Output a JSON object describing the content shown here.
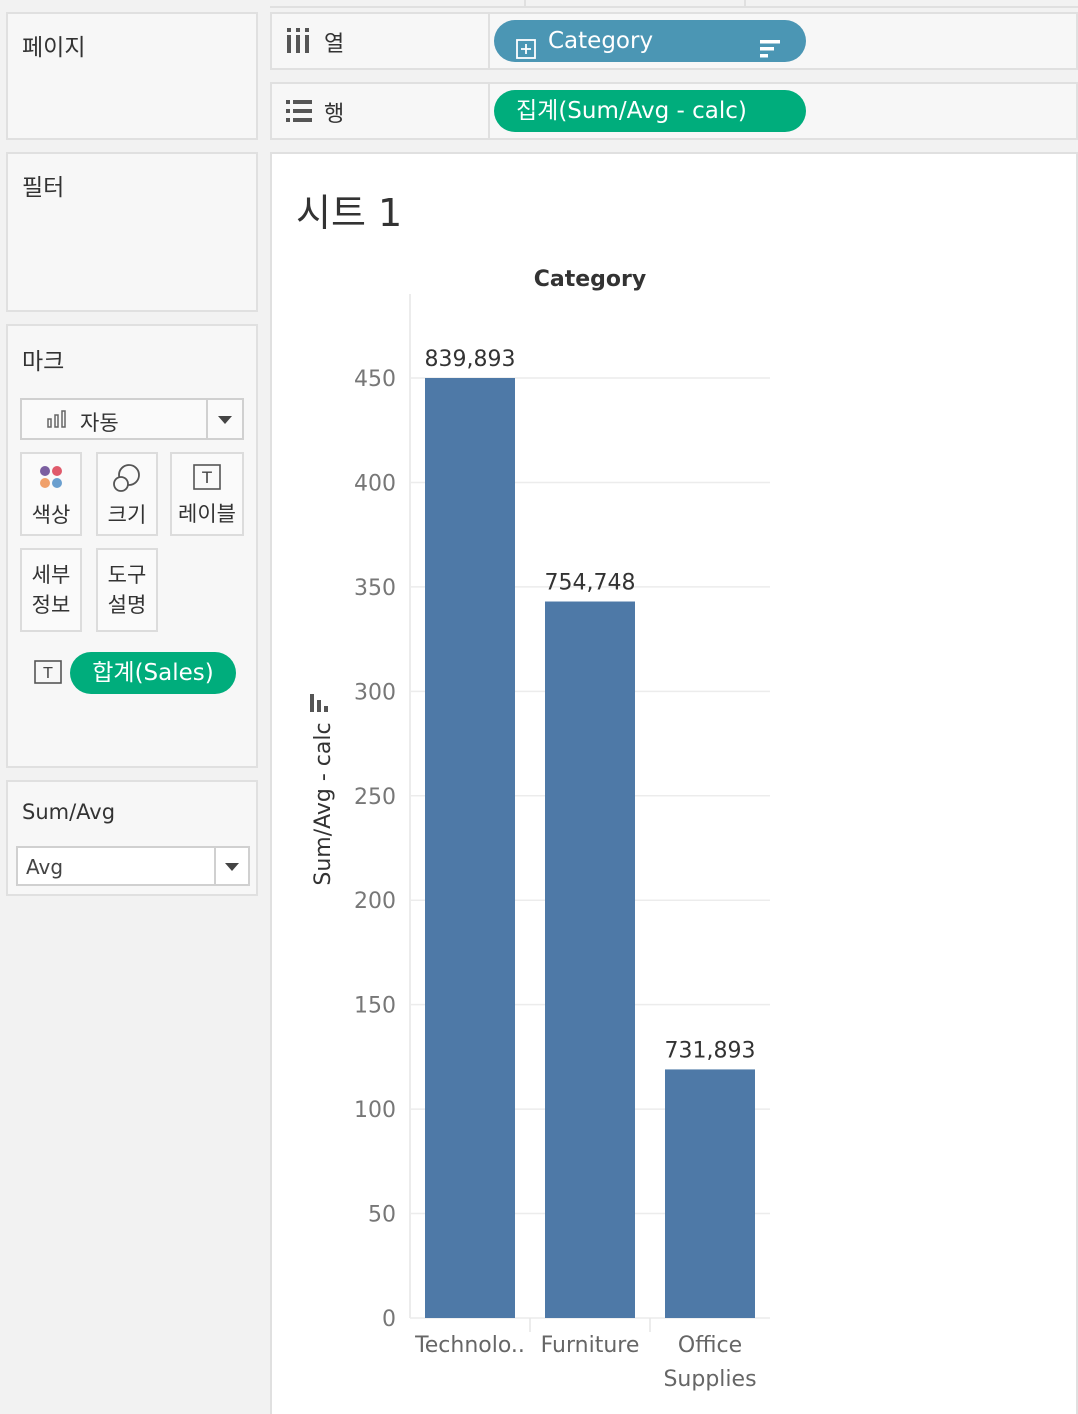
{
  "pages_panel": {
    "title": "페이지"
  },
  "filters_panel": {
    "title": "필터"
  },
  "marks_panel": {
    "title": "마크",
    "mark_type": "자동",
    "buttons": {
      "color": "색상",
      "size": "크기",
      "label": "레이블",
      "detail_line1": "세부",
      "detail_line2": "정보",
      "tooltip_line1": "도구",
      "tooltip_line2": "설명"
    },
    "label_pill": "합계(Sales)"
  },
  "parameter_panel": {
    "title": "Sum/Avg",
    "value": "Avg"
  },
  "shelves": {
    "columns": {
      "label": "열",
      "pill": "Category"
    },
    "rows": {
      "label": "행",
      "pill": "집계(Sum/Avg - calc)"
    }
  },
  "sheet": {
    "title": "시트 1"
  },
  "colors": {
    "bar": "#4e79a7",
    "pill_blue": "#4b96b4",
    "pill_green": "#00ad7c"
  },
  "chart_data": {
    "type": "bar",
    "title": "Category",
    "ylabel": "Sum/Avg - calc",
    "xlabel": "",
    "categories": [
      "Technolo..",
      "Furniture",
      "Office Supplies"
    ],
    "values": [
      450,
      343,
      119
    ],
    "data_labels": [
      "839,893",
      "754,748",
      "731,893"
    ],
    "ylim": [
      0,
      450
    ],
    "yticks": [
      0,
      50,
      100,
      150,
      200,
      250,
      300,
      350,
      400,
      450
    ],
    "grid": true
  }
}
